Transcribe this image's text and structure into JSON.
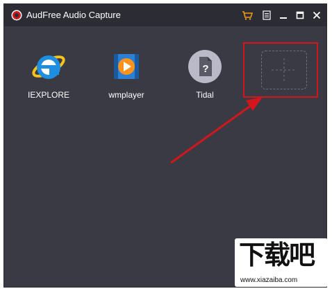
{
  "window": {
    "title": "AudFree Audio Capture",
    "title_controls": [
      "cart-icon",
      "menu-icon",
      "minimize-icon",
      "maximize-icon",
      "close-icon"
    ]
  },
  "apps": [
    {
      "label": "IEXPLORE",
      "icon": "internet-explorer-icon"
    },
    {
      "label": "wmplayer",
      "icon": "windows-media-player-icon"
    },
    {
      "label": "Tidal",
      "icon": "unknown-app-icon"
    }
  ],
  "add_slot": {
    "icon": "add-icon"
  },
  "colors": {
    "window_bg": "#3a3a45",
    "titlebar_bg": "#2c2c35",
    "highlight": "#d2161b",
    "cart": "#f39c12"
  },
  "watermark": {
    "text": "下载吧",
    "url": "www.xiazaiba.com"
  }
}
